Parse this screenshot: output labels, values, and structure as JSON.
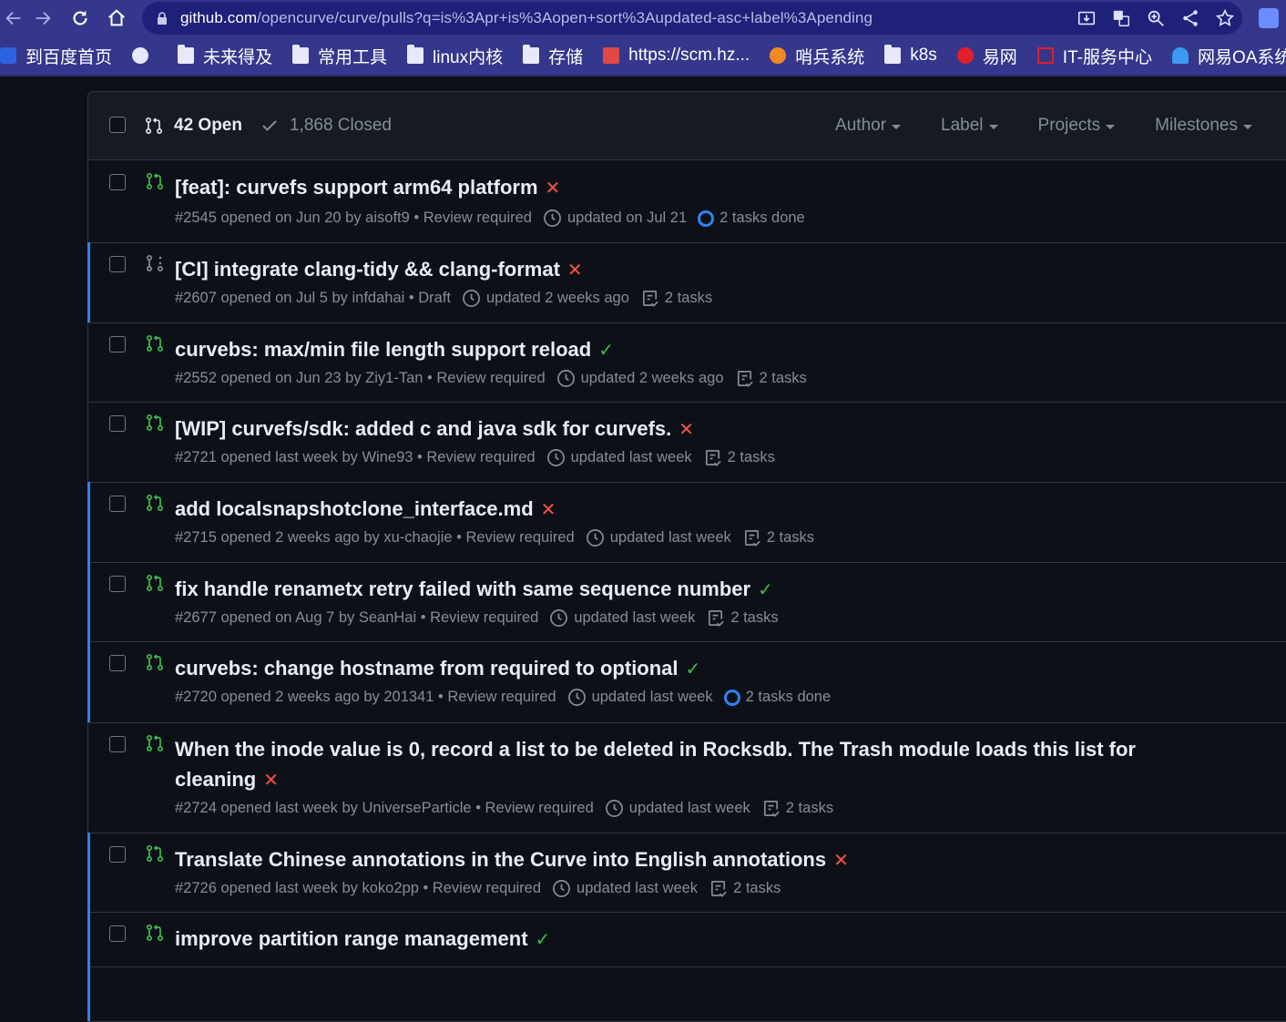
{
  "browser": {
    "url_host": "github.com",
    "url_path": "/opencurve/curve/pulls?q=is%3Apr+is%3Aopen+sort%3Aupdated-asc+label%3Apending",
    "bookmarks": [
      {
        "label": "到百度首页",
        "icon": "baidu-icon"
      },
      {
        "label": "",
        "icon": "globe-icon"
      },
      {
        "label": "未来得及",
        "icon": "folder-icon"
      },
      {
        "label": "常用工具",
        "icon": "folder-icon"
      },
      {
        "label": "linux内核",
        "icon": "folder-icon"
      },
      {
        "label": "存储",
        "icon": "folder-icon"
      },
      {
        "label": "https://scm.hz...",
        "icon": "scm-icon"
      },
      {
        "label": "哨兵系统",
        "icon": "sentinel-icon"
      },
      {
        "label": "k8s",
        "icon": "folder-icon"
      },
      {
        "label": "易网",
        "icon": "netease-icon"
      },
      {
        "label": "IT-服务中心",
        "icon": "it-icon"
      },
      {
        "label": "网易OA系统",
        "icon": "oa-icon"
      }
    ]
  },
  "header": {
    "open_label": "42 Open",
    "closed_label": "1,868 Closed",
    "filters": [
      "Author",
      "Label",
      "Projects",
      "Milestones"
    ]
  },
  "colors": {
    "accent": "#2f81f7",
    "success": "#3fb950",
    "fail": "#f85149"
  },
  "prs": [
    {
      "title": "[feat]: curvefs support arm64 platform",
      "status": "fail",
      "meta": "#2545 opened on Jun 20 by aisoft9 • Review required",
      "updated": "updated on Jul 21",
      "tasks": "2 tasks done",
      "tasks_done": true,
      "draft": false,
      "selected": false
    },
    {
      "title": "[CI] integrate clang-tidy && clang-format",
      "status": "fail",
      "meta": "#2607 opened on Jul 5 by infdahai • Draft",
      "updated": "updated 2 weeks ago",
      "tasks": "2 tasks",
      "tasks_done": false,
      "draft": true,
      "selected": true
    },
    {
      "title": "curvebs: max/min file length support reload",
      "status": "ok",
      "meta": "#2552 opened on Jun 23 by Ziy1-Tan • Review required",
      "updated": "updated 2 weeks ago",
      "tasks": "2 tasks",
      "tasks_done": false,
      "draft": false,
      "selected": false
    },
    {
      "title": "[WIP] curvefs/sdk: added c and java sdk for curvefs.",
      "status": "fail",
      "meta": "#2721 opened last week by Wine93 • Review required",
      "updated": "updated last week",
      "tasks": "2 tasks",
      "tasks_done": false,
      "draft": false,
      "selected": false
    },
    {
      "title": "add localsnapshotclone_interface.md",
      "status": "fail",
      "meta": "#2715 opened 2 weeks ago by xu-chaojie • Review required",
      "updated": "updated last week",
      "tasks": "2 tasks",
      "tasks_done": false,
      "draft": false,
      "selected": true
    },
    {
      "title": "fix handle renametx retry failed with same sequence number",
      "status": "ok",
      "meta": "#2677 opened on Aug 7 by SeanHai • Review required",
      "updated": "updated last week",
      "tasks": "2 tasks",
      "tasks_done": false,
      "draft": false,
      "selected": true
    },
    {
      "title": "curvebs: change hostname from required to optional",
      "status": "ok",
      "meta": "#2720 opened 2 weeks ago by 201341 • Review required",
      "updated": "updated last week",
      "tasks": "2 tasks done",
      "tasks_done": true,
      "draft": false,
      "selected": true
    },
    {
      "title": "When the inode value is 0, record a list to be deleted in Rocksdb. The Trash module loads this list for cleaning",
      "status": "fail",
      "meta": "#2724 opened last week by UniverseParticle • Review required",
      "updated": "updated last week",
      "tasks": "2 tasks",
      "tasks_done": false,
      "draft": false,
      "selected": false
    },
    {
      "title": "Translate Chinese annotations in the Curve into English annotations",
      "status": "fail",
      "meta": "#2726 opened last week by koko2pp • Review required",
      "updated": "updated last week",
      "tasks": "2 tasks",
      "tasks_done": false,
      "draft": false,
      "selected": true
    },
    {
      "title": "improve partition range management",
      "status": "ok",
      "meta": "",
      "updated": "",
      "tasks": "",
      "tasks_done": false,
      "draft": false,
      "selected": true
    }
  ]
}
